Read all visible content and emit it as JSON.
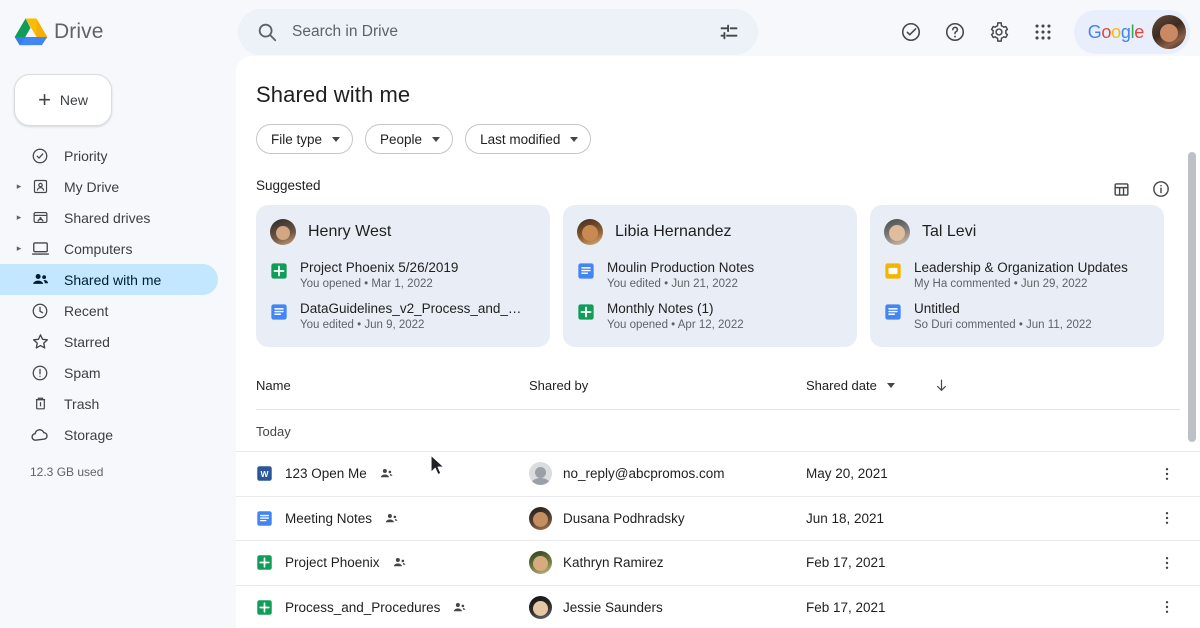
{
  "topbar": {
    "brand_name": "Drive",
    "logo_icon": "google-drive-logo",
    "search": {
      "placeholder": "Search in Drive",
      "value": "",
      "icon": "search-icon",
      "tune_icon": "tune-filter-icon"
    },
    "actions": [
      {
        "icon": "support-check-icon",
        "name": "activity-button"
      },
      {
        "icon": "help-question-icon",
        "name": "help-button"
      },
      {
        "icon": "gear-icon",
        "name": "settings-button"
      },
      {
        "icon": "apps-grid-icon",
        "name": "google-apps-button"
      }
    ],
    "account": {
      "logo_text": "Google",
      "avatar": "user-avatar"
    }
  },
  "sidebar": {
    "new_button": {
      "label": "New",
      "icon": "plus-icon"
    },
    "items": [
      {
        "label": "Priority",
        "icon": "check-circle-icon",
        "expandable": false,
        "active": false
      },
      {
        "label": "My Drive",
        "icon": "my-drive-icon",
        "expandable": true,
        "active": false
      },
      {
        "label": "Shared drives",
        "icon": "shared-drives-icon",
        "expandable": true,
        "active": false
      },
      {
        "label": "Computers",
        "icon": "computer-icon",
        "expandable": true,
        "active": false
      },
      {
        "label": "Shared with me",
        "icon": "people-icon",
        "expandable": false,
        "active": true
      },
      {
        "label": "Recent",
        "icon": "clock-icon",
        "expandable": false,
        "active": false
      },
      {
        "label": "Starred",
        "icon": "star-icon",
        "expandable": false,
        "active": false
      },
      {
        "label": "Spam",
        "icon": "spam-icon",
        "expandable": false,
        "active": false
      },
      {
        "label": "Trash",
        "icon": "trash-icon",
        "expandable": false,
        "active": false
      },
      {
        "label": "Storage",
        "icon": "cloud-icon",
        "expandable": false,
        "active": false
      }
    ],
    "storage_used": "12.3 GB used"
  },
  "main": {
    "title": "Shared with me",
    "chips": [
      {
        "label": "File type"
      },
      {
        "label": "People"
      },
      {
        "label": "Last modified"
      }
    ],
    "view_tools": [
      {
        "icon": "grid-view-icon",
        "name": "grid-view-button"
      },
      {
        "icon": "info-icon",
        "name": "details-button"
      }
    ],
    "suggested_label": "Suggested",
    "suggested": [
      {
        "person": "Henry West",
        "avatar_class": "av1",
        "files": [
          {
            "title": "Project Phoenix 5/26/2019",
            "sub": "You opened • Mar 1, 2022",
            "type": "sheets"
          },
          {
            "title": "DataGuidelines_v2_Process_and_Pr...",
            "sub": "You edited • Jun 9, 2022",
            "type": "docs"
          }
        ]
      },
      {
        "person": "Libia Hernandez",
        "avatar_class": "av2",
        "files": [
          {
            "title": "Moulin Production Notes",
            "sub": "You edited • Jun 21, 2022",
            "type": "docs"
          },
          {
            "title": "Monthly Notes (1)",
            "sub": "You opened • Apr 12, 2022",
            "type": "sheets"
          }
        ]
      },
      {
        "person": "Tal Levi",
        "avatar_class": "av3",
        "files": [
          {
            "title": "Leadership & Organization Updates",
            "sub": "My Ha commented • Jun 29, 2022",
            "type": "slides"
          },
          {
            "title": "Untitled",
            "sub": "So Duri commented • Jun 11, 2022",
            "type": "docs"
          }
        ]
      }
    ],
    "table": {
      "columns": {
        "name": "Name",
        "shared_by": "Shared by",
        "shared_date": "Shared date"
      },
      "sort_icon": "sort-descending-arrow-icon",
      "group_label": "Today",
      "rows": [
        {
          "name": "123 Open Me",
          "type": "word",
          "shared_by": "no_reply@abcpromos.com",
          "avatar_class": "av-gray",
          "date": "May 20, 2021"
        },
        {
          "name": "Meeting Notes",
          "type": "docs",
          "shared_by": "Dusana Podhradsky",
          "avatar_class": "av4",
          "date": "Jun 18, 2021"
        },
        {
          "name": "Project Phoenix",
          "type": "sheets",
          "shared_by": "Kathryn Ramirez",
          "avatar_class": "av5",
          "date": "Feb 17, 2021"
        },
        {
          "name": "Process_and_Procedures",
          "type": "sheets",
          "shared_by": "Jessie Saunders",
          "avatar_class": "av6",
          "date": "Feb 17, 2021"
        }
      ]
    }
  },
  "colors": {
    "accent_selected": "#c2e7ff",
    "card_bg": "#e9eef6",
    "sheets_green": "#0f9d58",
    "docs_blue": "#4285f4",
    "slides_yellow": "#f4b400",
    "word_blue": "#2b579a"
  }
}
